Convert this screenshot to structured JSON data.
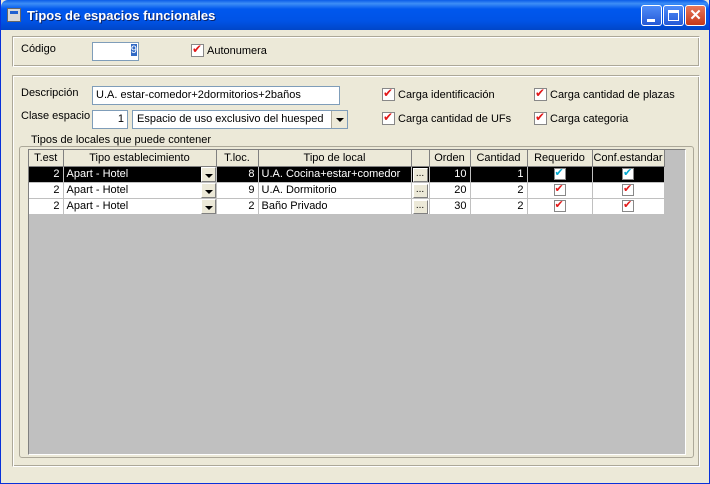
{
  "window": {
    "title": "Tipos de espacios funcionales"
  },
  "codigo": {
    "label": "Código",
    "value": "9"
  },
  "autonumera": {
    "label": "Autonumera",
    "checked": true
  },
  "descripcion": {
    "label": "Descripción",
    "value": "U.A. estar-comedor+2dormitorios+2baños"
  },
  "clase_espacio": {
    "label": "Clase espacio",
    "code": "1",
    "selected": "Espacio de uso exclusivo del huesped"
  },
  "checks": {
    "carga_identificacion": "Carga identificación",
    "carga_cantidad_ufs": "Carga cantidad de UFs",
    "carga_cantidad_plazas": "Carga cantidad de plazas",
    "carga_categoria": "Carga categoria"
  },
  "grid": {
    "group_title": "Tipos de locales que puede contener",
    "columns": [
      "T.est",
      "Tipo establecimiento",
      "T.loc.",
      "Tipo de local",
      "",
      "Orden",
      "Cantidad",
      "Requerido",
      "Conf.estandar"
    ],
    "rows": [
      {
        "test": "2",
        "tipo_est": "Apart - Hotel",
        "tloc": "8",
        "tipo_local": "U.A. Cocina+estar+comedor",
        "orden": "10",
        "cantidad": "1",
        "requerido": true,
        "conf": true
      },
      {
        "test": "2",
        "tipo_est": "Apart - Hotel",
        "tloc": "9",
        "tipo_local": "U.A. Dormitorio",
        "orden": "20",
        "cantidad": "2",
        "requerido": true,
        "conf": true
      },
      {
        "test": "2",
        "tipo_est": "Apart - Hotel",
        "tloc": "2",
        "tipo_local": "Baño Privado",
        "orden": "30",
        "cantidad": "2",
        "requerido": true,
        "conf": true
      }
    ],
    "ellipsis": "..."
  },
  "colors": {
    "titlebar": "#0058ee",
    "check_red": "#e21818",
    "check_cyan": "#00a8d0",
    "selected_row": "#000000"
  }
}
